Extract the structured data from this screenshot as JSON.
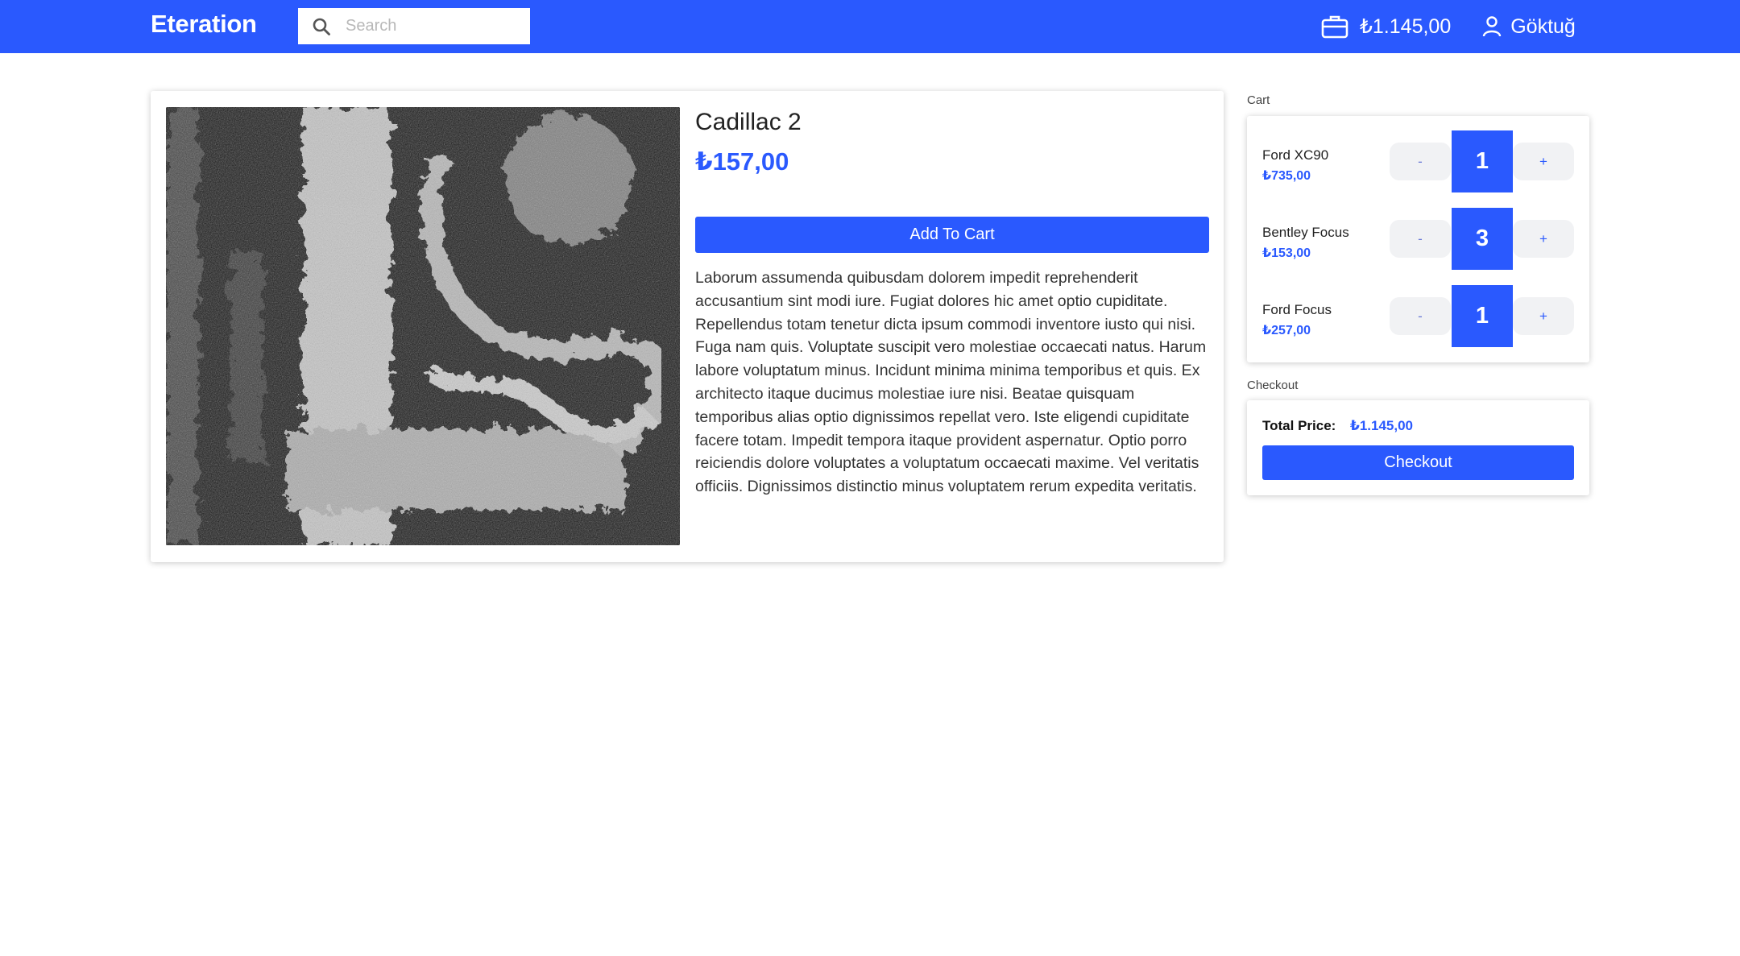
{
  "header": {
    "brand": "Eteration",
    "search_placeholder": "Search",
    "wallet_total": "₺1.145,00",
    "user_name": "Göktuğ"
  },
  "product": {
    "title": "Cadillac 2",
    "price": "₺157,00",
    "add_to_cart_label": "Add To Cart",
    "description": "Laborum assumenda quibusdam dolorem impedit reprehenderit accusantium sint modi iure. Fugiat dolores hic amet optio cupiditate. Repellendus totam tenetur dicta ipsum commodi inventore iusto qui nisi. Fuga nam quis. Voluptate suscipit vero molestiae occaecati natus. Harum labore voluptatum minus. Incidunt minima minima temporibus et quis. Ex architecto itaque ducimus molestiae iure nisi. Beatae quisquam temporibus alias optio dignissimos repellat vero. Iste eligendi cupiditate facere totam. Impedit tempora itaque provident aspernatur. Optio porro reiciendis dolore voluptates a voluptatum occaecati maxime. Vel veritatis officiis. Dignissimos distinctio minus voluptatem rerum expedita veritatis."
  },
  "cart": {
    "label": "Cart",
    "items": [
      {
        "name": "Ford XC90",
        "price": "₺735,00",
        "quantity": "1",
        "minus": "-",
        "plus": "+"
      },
      {
        "name": "Bentley Focus",
        "price": "₺153,00",
        "quantity": "3",
        "minus": "-",
        "plus": "+"
      },
      {
        "name": "Ford Focus",
        "price": "₺257,00",
        "quantity": "1",
        "minus": "-",
        "plus": "+"
      }
    ]
  },
  "checkout": {
    "label": "Checkout",
    "total_label": "Total Price:",
    "total_value": "₺1.145,00",
    "button_label": "Checkout"
  },
  "colors": {
    "accent": "#2a59fe",
    "qty_button_bg": "#f1f2f4"
  }
}
